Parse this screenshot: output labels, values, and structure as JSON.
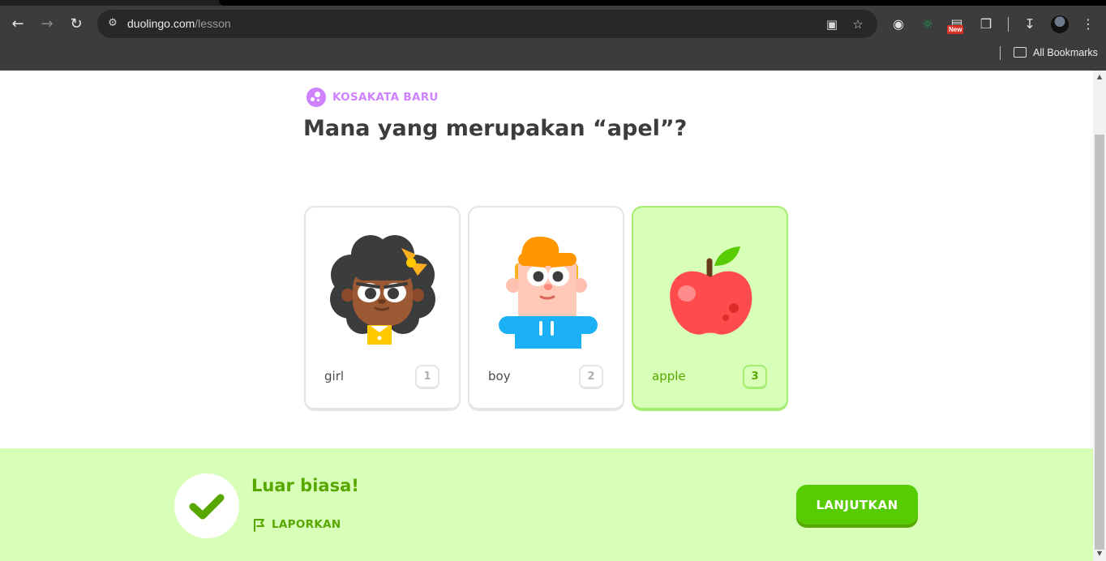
{
  "browser": {
    "url_host": "duolingo.com",
    "url_path": "/lesson",
    "new_badge": "New",
    "bookmarks_label": "All Bookmarks",
    "icons": [
      "back-icon",
      "forward-icon",
      "reload-icon",
      "site-info-icon",
      "install-app-icon",
      "bookmark-star-icon",
      "camera-icon",
      "eye-extension-icon",
      "extension-new-icon",
      "extensions-puzzle-icon",
      "download-icon",
      "profile-avatar",
      "menu-kebab-icon",
      "folder-icon"
    ]
  },
  "lesson": {
    "tag_label": "KOSAKATA BARU",
    "question": "Mana yang merupakan “apel”?",
    "choices": [
      {
        "label": "girl",
        "key": "1",
        "image": "girl-illustration",
        "selected": false
      },
      {
        "label": "boy",
        "key": "2",
        "image": "boy-illustration",
        "selected": false
      },
      {
        "label": "apple",
        "key": "3",
        "image": "apple-illustration",
        "selected": true
      }
    ]
  },
  "feedback": {
    "title": "Luar biasa!",
    "report_label": "LAPORKAN",
    "continue_label": "LANJUTKAN"
  },
  "colors": {
    "accent_green": "#58cc02",
    "dark_green": "#58a700",
    "success_bg": "#d7ffb8",
    "tag_purple": "#ce82ff",
    "text_dark": "#3c3c3c"
  }
}
